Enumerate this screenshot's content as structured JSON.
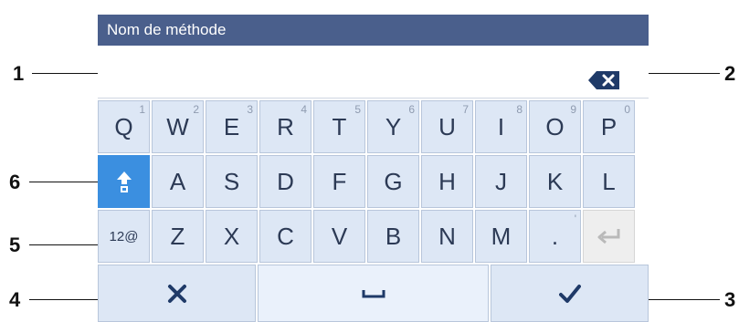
{
  "title_bar": {
    "title": "Nom de méthode"
  },
  "input": {
    "value": ""
  },
  "keyboard": {
    "row1": [
      {
        "char": "Q",
        "digit": "1"
      },
      {
        "char": "W",
        "digit": "2"
      },
      {
        "char": "E",
        "digit": "3"
      },
      {
        "char": "R",
        "digit": "4"
      },
      {
        "char": "T",
        "digit": "5"
      },
      {
        "char": "Y",
        "digit": "6"
      },
      {
        "char": "U",
        "digit": "7"
      },
      {
        "char": "I",
        "digit": "8"
      },
      {
        "char": "O",
        "digit": "9"
      },
      {
        "char": "P",
        "digit": "0"
      }
    ],
    "row2": [
      "A",
      "S",
      "D",
      "F",
      "G",
      "H",
      "J",
      "K",
      "L"
    ],
    "row3": [
      "Z",
      "X",
      "C",
      "V",
      "B",
      "N",
      "M",
      "."
    ],
    "row3_secondary": "'",
    "symbols_label": "12@",
    "icons": {
      "backspace": "backspace-icon",
      "shift": "shift-icon",
      "enter": "enter-icon",
      "cancel": "cancel-x-icon",
      "space": "space-icon",
      "confirm": "checkmark-icon"
    }
  },
  "callouts": [
    "1",
    "2",
    "3",
    "4",
    "5",
    "6"
  ],
  "colors": {
    "title_bar": "#4a5f8c",
    "key": "#dde7f5",
    "shift_active": "#3b8fe0",
    "text": "#2c3a55"
  }
}
